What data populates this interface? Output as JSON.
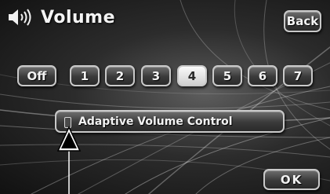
{
  "header": {
    "title": "Volume",
    "icon": "speaker-volume-icon",
    "back_label": "Back"
  },
  "volume_levels": {
    "options": [
      "Off",
      "1",
      "2",
      "3",
      "4",
      "5",
      "6",
      "7"
    ],
    "selected": "4"
  },
  "adaptive_volume": {
    "label": "Adaptive Volume Control",
    "enabled": false
  },
  "footer": {
    "ok_label": "OK"
  },
  "colors": {
    "background": "#2c2c2c",
    "button_face": "#3a3a3a",
    "button_border": "#c9c9c9",
    "selected_face": "#e6e6e6",
    "text": "#f2f2f2"
  }
}
